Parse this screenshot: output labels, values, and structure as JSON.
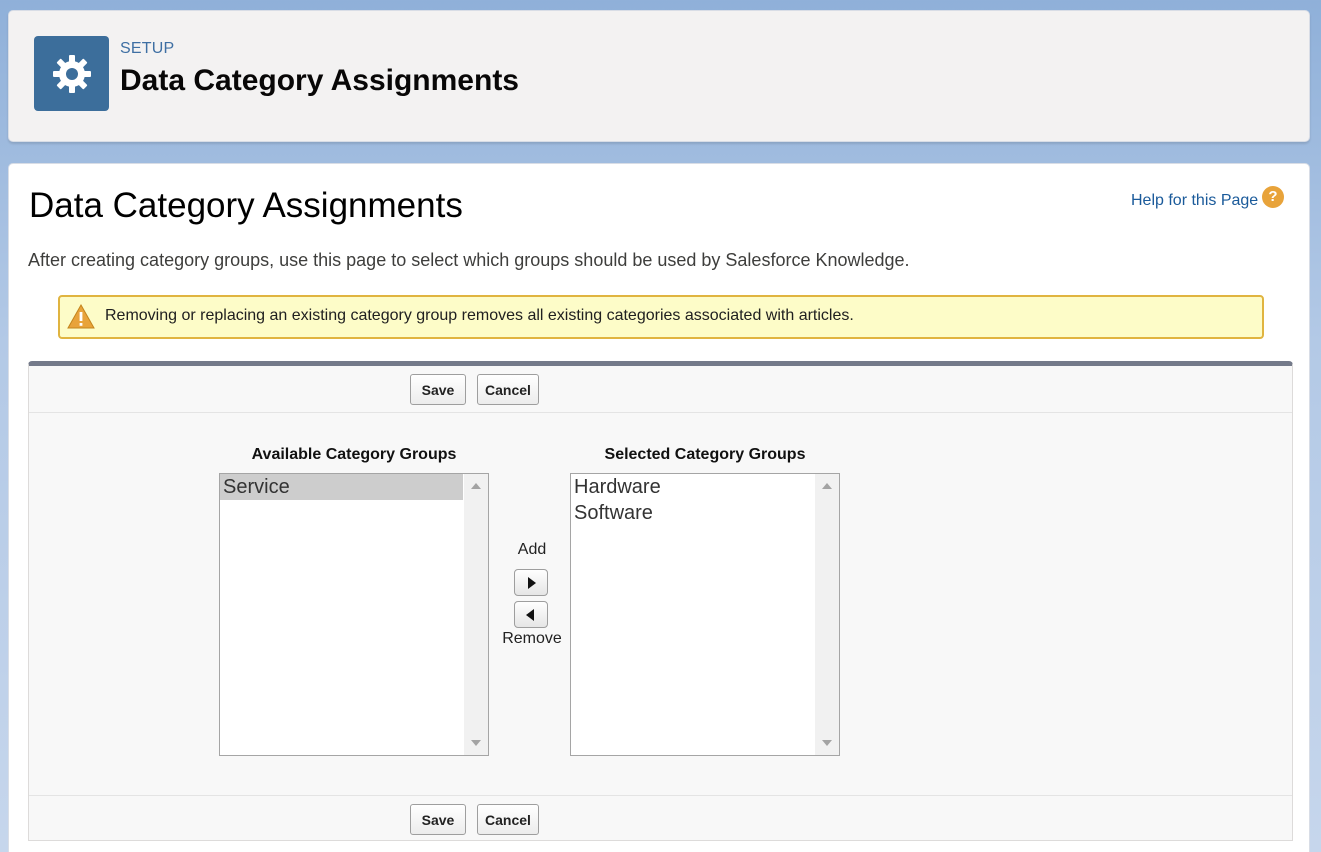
{
  "header": {
    "eyebrow": "SETUP",
    "title": "Data Category Assignments",
    "icon": "gear-icon"
  },
  "main": {
    "title": "Data Category Assignments",
    "help_link": "Help for this Page",
    "help_icon": "question-mark-icon",
    "help_icon_glyph": "?",
    "description": "After creating category groups, use this page to select which groups should be used by Salesforce Knowledge.",
    "warning": {
      "icon": "warning-triangle-icon",
      "text": "Removing or replacing an existing category group removes all existing categories associated with articles."
    }
  },
  "form": {
    "save_label": "Save",
    "cancel_label": "Cancel",
    "available": {
      "label": "Available Category Groups",
      "options": [
        "Service"
      ],
      "highlighted_option": "Service"
    },
    "selected": {
      "label": "Selected Category Groups",
      "options": [
        "Hardware",
        "Software"
      ]
    },
    "add_label": "Add",
    "remove_label": "Remove"
  },
  "colors": {
    "header_icon_bg": "#3c6e9b",
    "warning_bg": "#fdfcc8",
    "warning_border": "#e0b440",
    "help_icon": "#e8a33a",
    "link": "#1a5a9a"
  }
}
